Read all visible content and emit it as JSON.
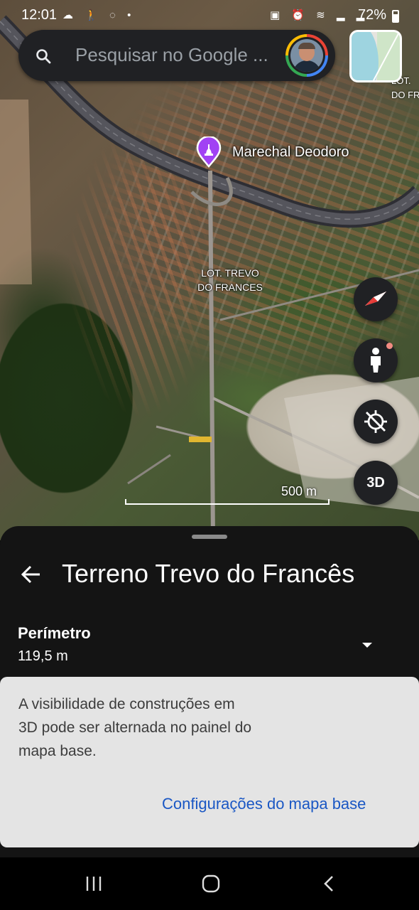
{
  "status_bar": {
    "time": "12:01",
    "left_icons": [
      "cloud-icon",
      "walk-icon",
      "sound-icon",
      "dot-icon"
    ],
    "left_icons_glyphs": "☁ 🚶 ◌ •",
    "right_icons_glyphs": "▣ ⏰ ≋ ▂ ▂",
    "battery": "72%"
  },
  "search": {
    "placeholder": "Pesquisar no Google ..."
  },
  "map": {
    "place_label": "Marechal Deodoro",
    "area_label_line1": "LOT. TREVO",
    "area_label_line2": "DO FRANCES",
    "edge_label_line1": "LOT.",
    "edge_label_line2": "DO FR",
    "scale": "500 m"
  },
  "fabs": {
    "threed": "3D"
  },
  "sheet": {
    "title": "Terreno Trevo do Francês",
    "metric_label": "Perímetro",
    "metric_value": "119,5 m"
  },
  "snackbar": {
    "message": "A visibilidade de construções em 3D pode ser alternada no painel do mapa base.",
    "action": "Configurações do mapa base"
  },
  "colors": {
    "accent": "#1a57c4",
    "sheet_bg": "#141414",
    "search_bg": "#202124",
    "snackbar_bg": "#e4e4e4",
    "place_pin": "#a142f4"
  }
}
